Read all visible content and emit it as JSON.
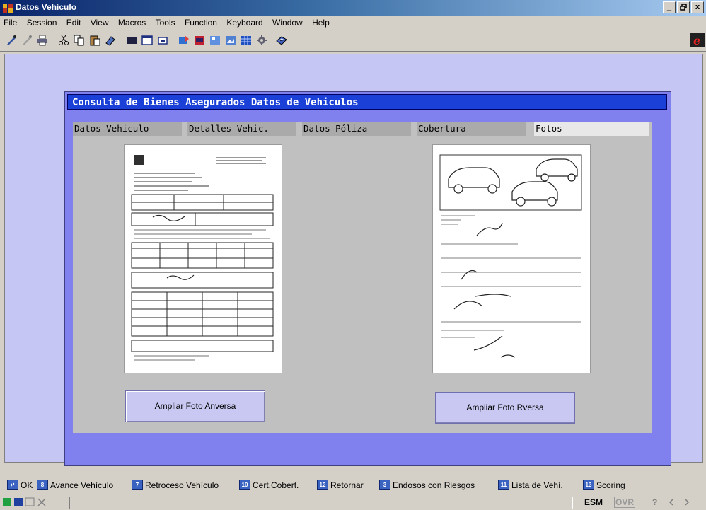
{
  "window": {
    "title": "Datos Vehículo",
    "controls": {
      "minimize": "_",
      "restore": " ",
      "close": "x"
    }
  },
  "menu": [
    "File",
    "Session",
    "Edit",
    "View",
    "Macros",
    "Tools",
    "Function",
    "Keyboard",
    "Window",
    "Help"
  ],
  "toolbar_icons": [
    "connect-icon",
    "disconnect-icon",
    "print-icon",
    "cut-icon",
    "copy-icon",
    "paste-icon",
    "eraser-icon",
    "screen-icon",
    "window-icon",
    "window-small-icon",
    "send-icon",
    "receive-icon",
    "transfer-icon",
    "image-icon",
    "grid-icon",
    "settings-icon",
    "macro-icon",
    "brand-logo-icon"
  ],
  "panel": {
    "title": "Consulta de Bienes Asegurados Datos de Vehiculos",
    "tabs": [
      "Datos Vehiculo",
      "Detalles Vehic.",
      "Datos Póliza",
      "Cobertura",
      "Fotos"
    ],
    "active_tab": "Fotos"
  },
  "buttons": {
    "front": "Ampliar Foto Anversa",
    "back": "Ampliar Foto Rversa"
  },
  "function_keys": [
    {
      "key": "↵",
      "label": "OK"
    },
    {
      "key": "8",
      "label": "Avance Vehículo"
    },
    {
      "key": "7",
      "label": "Retroceso Vehículo"
    },
    {
      "key": "10",
      "label": "Cert.Cobert."
    },
    {
      "key": "12",
      "label": "Retornar"
    },
    {
      "key": "3",
      "label": "Endosos con Riesgos"
    },
    {
      "key": "11",
      "label": "Lista de Vehí."
    },
    {
      "key": "13",
      "label": "Scoring"
    }
  ],
  "status": {
    "mode": "ESM",
    "ovr": "OVR",
    "help": "?"
  },
  "colors": {
    "panel_title": "#1a40d8",
    "panel_frame": "#8080ee",
    "client_bg": "#c6c6f4",
    "button_bg": "#c8c8f2"
  }
}
